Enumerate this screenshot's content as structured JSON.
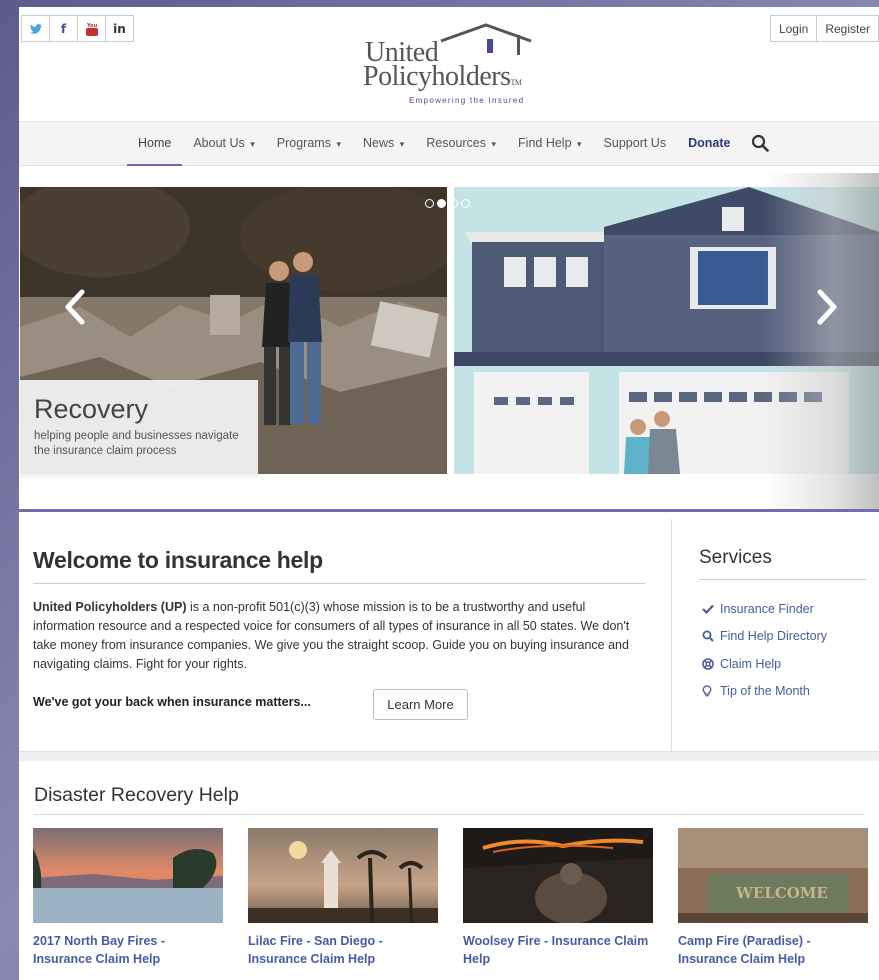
{
  "header": {
    "social": [
      {
        "icon": "twitter-icon",
        "glyph": "🐦"
      },
      {
        "icon": "facebook-icon",
        "glyph": "f"
      },
      {
        "icon": "youtube-icon",
        "glyph": "▶"
      },
      {
        "icon": "linkedin-icon",
        "glyph": "in"
      }
    ],
    "login_label": "Login",
    "register_label": "Register",
    "logo_line1": "United",
    "logo_line2": "Policyholders",
    "logo_tagline": "Empowering the Insured"
  },
  "nav": {
    "items": [
      {
        "label": "Home",
        "dropdown": false
      },
      {
        "label": "About Us",
        "dropdown": true
      },
      {
        "label": "Programs",
        "dropdown": true
      },
      {
        "label": "News",
        "dropdown": true
      },
      {
        "label": "Resources",
        "dropdown": true
      },
      {
        "label": "Find Help",
        "dropdown": true
      },
      {
        "label": "Support Us",
        "dropdown": false
      },
      {
        "label": "Donate",
        "dropdown": false
      }
    ],
    "caret": "▾"
  },
  "carousel": {
    "caption_title": "Recovery",
    "caption_text": "helping people and businesses navigate the insurance claim process",
    "active_index": 1,
    "slide_count": 4
  },
  "welcome": {
    "title": "Welcome to insurance help",
    "org_name": "United Policyholders (UP)",
    "body": " is a non-profit 501(c)(3) whose mission is to be a trustworthy and useful information resource and a respected voice for consumers of all types of insurance in all 50 states. We don't take money from insurance companies. We give you the straight scoop. Guide you on buying insurance and navigating claims. Fight for your rights.",
    "backline": "We've got your back when insurance matters...",
    "learn_more_label": "Learn More"
  },
  "services": {
    "title": "Services",
    "items": [
      {
        "label": "Insurance Finder",
        "icon": "checkmark-icon"
      },
      {
        "label": "Find Help Directory",
        "icon": "search-icon"
      },
      {
        "label": "Claim Help",
        "icon": "lifebuoy-icon"
      },
      {
        "label": "Tip of the Month",
        "icon": "lightbulb-icon"
      }
    ]
  },
  "disaster": {
    "title": "Disaster Recovery Help",
    "cards": [
      {
        "title": "2017 North Bay Fires - Insurance Claim Help"
      },
      {
        "title": "Lilac Fire - San Diego - Insurance Claim Help"
      },
      {
        "title": "Woolsey Fire - Insurance Claim Help"
      },
      {
        "title": "Camp Fire (Paradise) - Insurance Claim Help"
      }
    ]
  },
  "colors": {
    "accent": "#6f6fab",
    "link": "#4a5aa0",
    "donate": "#2f3a7a"
  }
}
